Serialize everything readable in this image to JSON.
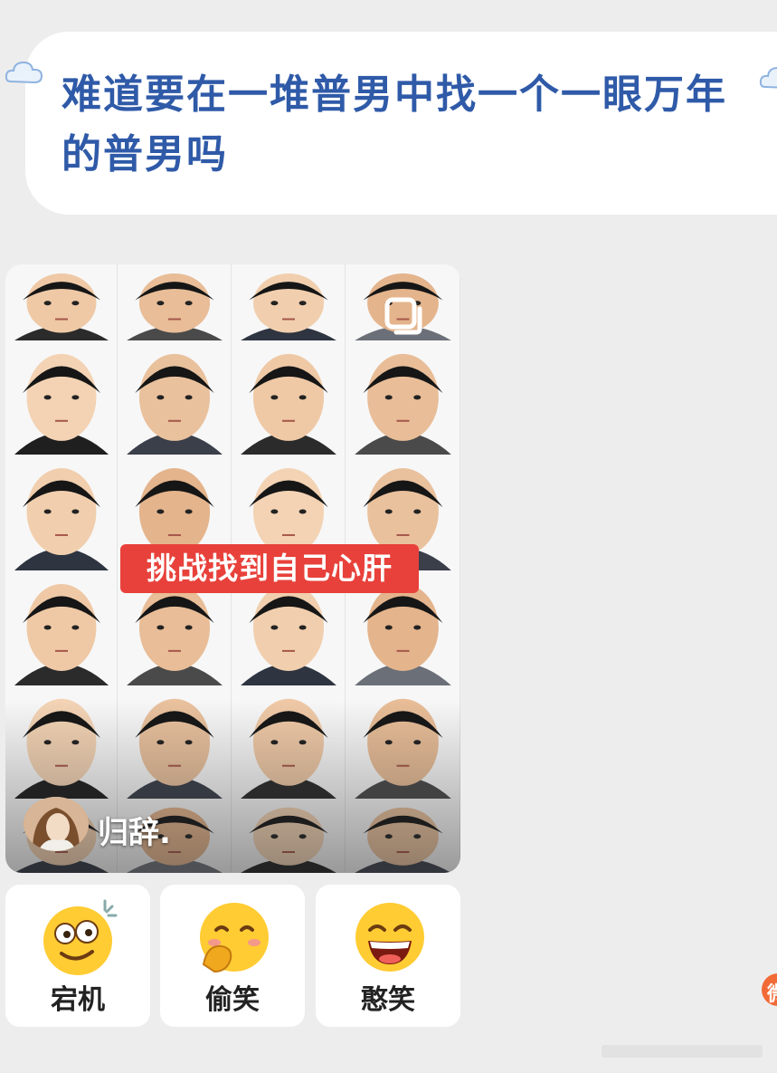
{
  "message": {
    "text": "难道要在一堆普男中找一个一眼万年的普男吗",
    "text_color": "#2f5aa8",
    "bubble_color": "#ffffff"
  },
  "video_card": {
    "caption": "挑战找到自己心肝",
    "caption_bg": "#e8413b",
    "author_name": "归辞.",
    "corner_icon": "copy-icon"
  },
  "reactions": [
    {
      "label": "宕机",
      "icon": "dazed-face-icon"
    },
    {
      "label": "偷笑",
      "icon": "snicker-face-icon"
    },
    {
      "label": "憨笑",
      "icon": "grin-face-icon"
    }
  ],
  "side_badge": {
    "char": "微",
    "color": "#f26a35"
  }
}
